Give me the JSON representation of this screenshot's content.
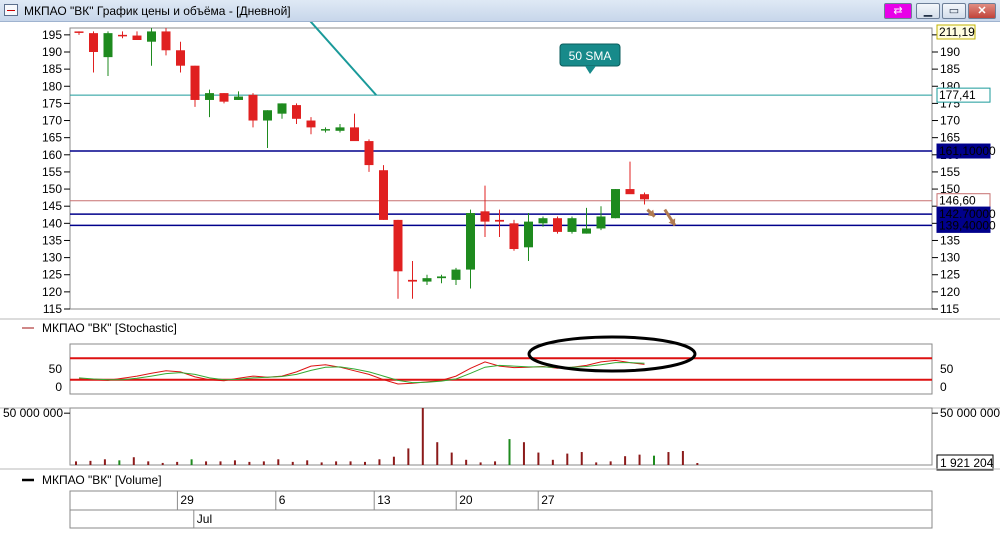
{
  "window": {
    "title": "МКПАО \"ВК\" График цены и объёма - [Дневной]",
    "buttons": {
      "link": "⇄",
      "minimize": "▁",
      "maximize": "▭",
      "close": "✕"
    }
  },
  "panes": {
    "stochastic_legend": "МКПАО \"ВК\" [Stochastic]",
    "volume_legend": "МКПАО \"ВК\" [Volume]"
  },
  "annotations": {
    "sma_callout": "50 SMA"
  },
  "colors": {
    "up_candle": "#1e8a1e",
    "down_candle": "#e02020",
    "volume_bar": "#8b1a1a",
    "sma": "#1a9a9a",
    "support_line": "#00008b",
    "stoch_band": "#dd1111"
  },
  "chart_data": [
    {
      "type": "candlestick",
      "name": "price",
      "ylim": [
        115,
        197
      ],
      "y_ticks": [
        115,
        120,
        125,
        130,
        135,
        140,
        145,
        150,
        155,
        160,
        165,
        170,
        175,
        180,
        185,
        190,
        195
      ],
      "y_tick_labels": [
        "115",
        "120",
        "125",
        "130",
        "135",
        "140",
        "145",
        "150",
        "155",
        "160",
        "165",
        "170",
        "175",
        "180",
        "185",
        "190",
        "195"
      ],
      "ohlc": [
        [
          196,
          196,
          195,
          195.8
        ],
        [
          195.5,
          196,
          184,
          190
        ],
        [
          188.5,
          196,
          183,
          195.5
        ],
        [
          195,
          196,
          194,
          194.8
        ],
        [
          194.8,
          196,
          193.5,
          193.5
        ],
        [
          193,
          197,
          186,
          196
        ],
        [
          196,
          197,
          189,
          190.5
        ],
        [
          190.5,
          193,
          184,
          186
        ],
        [
          186,
          186,
          174,
          176
        ],
        [
          176,
          179,
          171,
          178
        ],
        [
          178,
          178,
          175,
          175.5
        ],
        [
          176,
          178.5,
          176,
          177
        ],
        [
          177.5,
          178,
          168,
          170
        ],
        [
          170,
          173,
          162,
          173
        ],
        [
          172,
          175,
          170.5,
          175
        ],
        [
          174.5,
          175,
          169,
          170.5
        ],
        [
          170,
          171,
          166,
          168
        ],
        [
          167.5,
          168,
          166.5,
          167.5
        ],
        [
          167,
          169,
          166.5,
          168
        ],
        [
          168,
          172,
          165,
          164
        ],
        [
          164,
          164.5,
          155,
          157
        ],
        [
          155.5,
          157,
          141,
          141
        ],
        [
          141,
          141,
          118,
          126
        ],
        [
          123.5,
          129,
          118,
          123
        ],
        [
          123,
          125,
          122,
          124
        ],
        [
          124,
          125,
          122.5,
          124.5
        ],
        [
          123.5,
          127,
          122,
          126.5
        ],
        [
          126.5,
          144,
          121,
          143
        ],
        [
          143.5,
          151,
          136,
          140.5
        ],
        [
          141,
          144,
          136,
          140.5
        ],
        [
          140,
          141,
          132,
          132.5
        ],
        [
          133,
          143,
          129,
          140.5
        ],
        [
          140,
          142,
          139,
          141.5
        ],
        [
          141.5,
          142,
          137,
          137.5
        ],
        [
          137.5,
          142,
          137,
          141.5
        ],
        [
          137,
          144.5,
          137,
          138.5
        ],
        [
          138.5,
          145,
          138,
          142
        ],
        [
          141.5,
          150,
          141.5,
          150
        ],
        [
          150,
          158,
          149,
          148.5
        ],
        [
          148.5,
          149,
          145.5,
          147
        ]
      ],
      "horizontal_levels": [
        {
          "label": "177,41",
          "value": 177.41,
          "color": "#1a9a9a"
        },
        {
          "label": "161,10000",
          "value": 161.1,
          "color": "#00008b"
        },
        {
          "label": "146,60",
          "value": 146.6,
          "color": "#c77070"
        },
        {
          "label": "142,70000",
          "value": 142.7,
          "color": "#00008b"
        },
        {
          "label": "139,40000",
          "value": 139.4,
          "color": "#00008b"
        }
      ],
      "top_label": "211,19",
      "sma": {
        "name": "50 SMA",
        "from": {
          "x": 15,
          "y": 203.5
        },
        "to": {
          "x": 20.5,
          "y": 177.41
        }
      }
    },
    {
      "type": "line",
      "name": "Stochastic",
      "ylim": [
        -20,
        120
      ],
      "y_ticks": [
        0,
        50
      ],
      "y_tick_labels": [
        "0",
        "50"
      ],
      "bands": [
        20,
        80
      ],
      "series": [
        {
          "color": "#dd1111",
          "values": [
            22,
            20,
            18,
            24,
            30,
            38,
            45,
            42,
            28,
            20,
            17,
            24,
            30,
            27,
            30,
            42,
            58,
            62,
            55,
            45,
            35,
            20,
            8,
            10,
            14,
            18,
            30,
            52,
            70,
            58,
            54,
            55,
            57,
            52,
            55,
            60,
            70,
            74,
            68,
            63
          ]
        },
        {
          "color": "#33aa33",
          "values": [
            25,
            22,
            20,
            20,
            24,
            30,
            37,
            40,
            35,
            25,
            20,
            21,
            25,
            27,
            29,
            35,
            46,
            55,
            56,
            50,
            42,
            30,
            18,
            12,
            13,
            16,
            22,
            38,
            55,
            60,
            58,
            56,
            56,
            54,
            55,
            57,
            62,
            68,
            68,
            66
          ]
        }
      ]
    },
    {
      "type": "bar",
      "name": "Volume",
      "ylim": [
        0,
        55000000
      ],
      "y_ticks": [
        50000000
      ],
      "y_tick_labels": [
        "50 000 000"
      ],
      "last_value_label": "1 921 204",
      "values": [
        3500000,
        4000000,
        5500000,
        4500000,
        7500000,
        3500000,
        2000000,
        3000000,
        5500000,
        3500000,
        3500000,
        4500000,
        3000000,
        3500000,
        5500000,
        3000000,
        4500000,
        2500000,
        3500000,
        3500000,
        3000000,
        5500000,
        8000000,
        16000000,
        55000000,
        22000000,
        12000000,
        5000000,
        2500000,
        3500000,
        25000000,
        22000000,
        12000000,
        5000000,
        11000000,
        12500000,
        2500000,
        3500000,
        8500000,
        10000000,
        9000000,
        12500000,
        13500000,
        1921204
      ],
      "colors_up": [
        false,
        false,
        false,
        true,
        false,
        false,
        false,
        false,
        true,
        false,
        false,
        false,
        false,
        false,
        false,
        false,
        false,
        false,
        false,
        false,
        false,
        false,
        false,
        false,
        false,
        false,
        false,
        false,
        false,
        false,
        true,
        false,
        false,
        false,
        false,
        false,
        false,
        false,
        false,
        false,
        true,
        false,
        false,
        false
      ]
    }
  ],
  "time_axis": {
    "day_labels": [
      {
        "label": "29",
        "index": 6
      },
      {
        "label": "6",
        "index": 12
      },
      {
        "label": "13",
        "index": 18
      },
      {
        "label": "20",
        "index": 23
      },
      {
        "label": "27",
        "index": 28
      }
    ],
    "month_labels": [
      {
        "label": "Jul",
        "index": 7
      }
    ]
  },
  "arrows": [
    {
      "from": [
        39.2,
        144
      ],
      "to": [
        39.7,
        142
      ]
    },
    {
      "from": [
        40.4,
        144
      ],
      "to": [
        41.1,
        139.4
      ]
    }
  ]
}
